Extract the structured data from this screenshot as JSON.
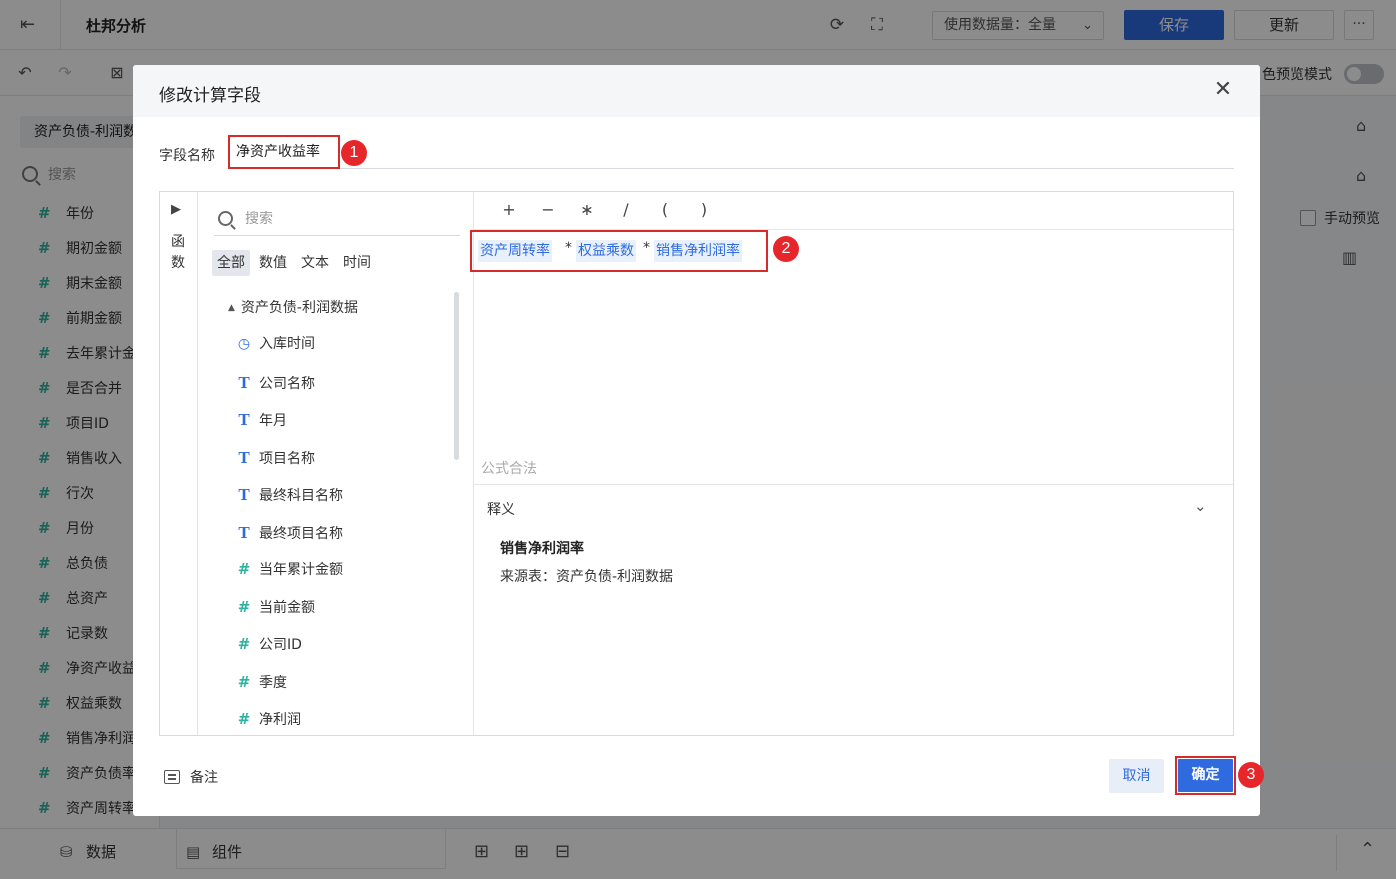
{
  "header": {
    "title": "杜邦分析",
    "data_volume": "使用数据量：全量",
    "save_label": "保存",
    "update_label": "更新",
    "more_label": "···"
  },
  "toolbar": {
    "preview_label": "色预览模式"
  },
  "left_panel": {
    "dataset_tab": "资产负债-利润数据",
    "search_placeholder": "搜索",
    "fields": [
      "年份",
      "期初金额",
      "期末金额",
      "前期金额",
      "去年累计金额",
      "是否合并",
      "项目ID",
      "销售收入",
      "行次",
      "月份",
      "总负债",
      "总资产",
      "记录数",
      "净资产收益率",
      "权益乘数",
      "销售净利润率",
      "资产负债率",
      "资产周转率"
    ]
  },
  "right_panel": {
    "manual_preview": "手动预览"
  },
  "bottom_bar": {
    "data_tab": "数据",
    "component_tab": "组件"
  },
  "dialog": {
    "title": "修改计算字段",
    "close_label": "✕",
    "field_name_label": "字段名称",
    "field_name_value": "净资产收益率",
    "function_strip": "函数",
    "search_placeholder": "搜索",
    "filter_tabs": [
      "全部",
      "数值",
      "文本",
      "时间"
    ],
    "tree_root": "资产负债-利润数据",
    "tree_fields": [
      {
        "name": "入库时间",
        "type": "time"
      },
      {
        "name": "公司名称",
        "type": "text"
      },
      {
        "name": "年月",
        "type": "text"
      },
      {
        "name": "项目名称",
        "type": "text"
      },
      {
        "name": "最终科目名称",
        "type": "text"
      },
      {
        "name": "最终项目名称",
        "type": "text"
      },
      {
        "name": "当年累计金额",
        "type": "number"
      },
      {
        "name": "当前金额",
        "type": "number"
      },
      {
        "name": "公司ID",
        "type": "number"
      },
      {
        "name": "季度",
        "type": "number"
      },
      {
        "name": "净利润",
        "type": "number"
      }
    ],
    "operators": [
      "+",
      "−",
      "∗",
      "/",
      "(",
      ")"
    ],
    "formula_tokens": [
      "资产周转率",
      "权益乘数",
      "销售净利润率"
    ],
    "formula_op": "*",
    "formula_status": "公式合法",
    "explain_title": "释义",
    "explain_field": "销售净利润率",
    "explain_source": "来源表：资产负债-利润数据",
    "notes_label": "备注",
    "cancel_label": "取消",
    "ok_label": "确定"
  },
  "annotations": [
    "1",
    "2",
    "3"
  ],
  "colors": {
    "primary": "#2f6bde",
    "highlight_border": "#d62b2b",
    "badge": "#e6262a",
    "number_icon": "#2db3a0"
  }
}
